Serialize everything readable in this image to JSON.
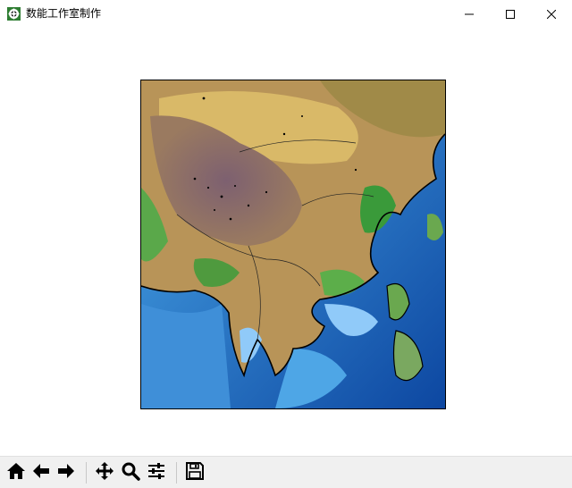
{
  "window": {
    "title": "数能工作室制作",
    "controls": {
      "minimize_icon": "minimize-icon",
      "maximize_icon": "maximize-icon",
      "close_icon": "close-icon"
    }
  },
  "figure": {
    "content": "terrain-relief-map"
  },
  "toolbar": {
    "buttons": [
      {
        "name": "home-button",
        "icon": "home-icon"
      },
      {
        "name": "back-button",
        "icon": "arrow-left-icon"
      },
      {
        "name": "forward-button",
        "icon": "arrow-right-icon"
      },
      {
        "name": "pan-button",
        "icon": "move-arrows-icon"
      },
      {
        "name": "zoom-button",
        "icon": "magnifier-icon"
      },
      {
        "name": "configure-subplots-button",
        "icon": "sliders-icon"
      },
      {
        "name": "save-button",
        "icon": "floppy-disk-icon"
      }
    ]
  },
  "colors": {
    "titlebar_bg": "#ffffff",
    "toolbar_bg": "#f0f0f0",
    "ocean_deep": "#1565c0",
    "ocean_shallow": "#90caf9",
    "lowland_green": "#3a9a3a",
    "plateau_brown": "#8a6a5a",
    "desert_tan": "#c8a860"
  }
}
